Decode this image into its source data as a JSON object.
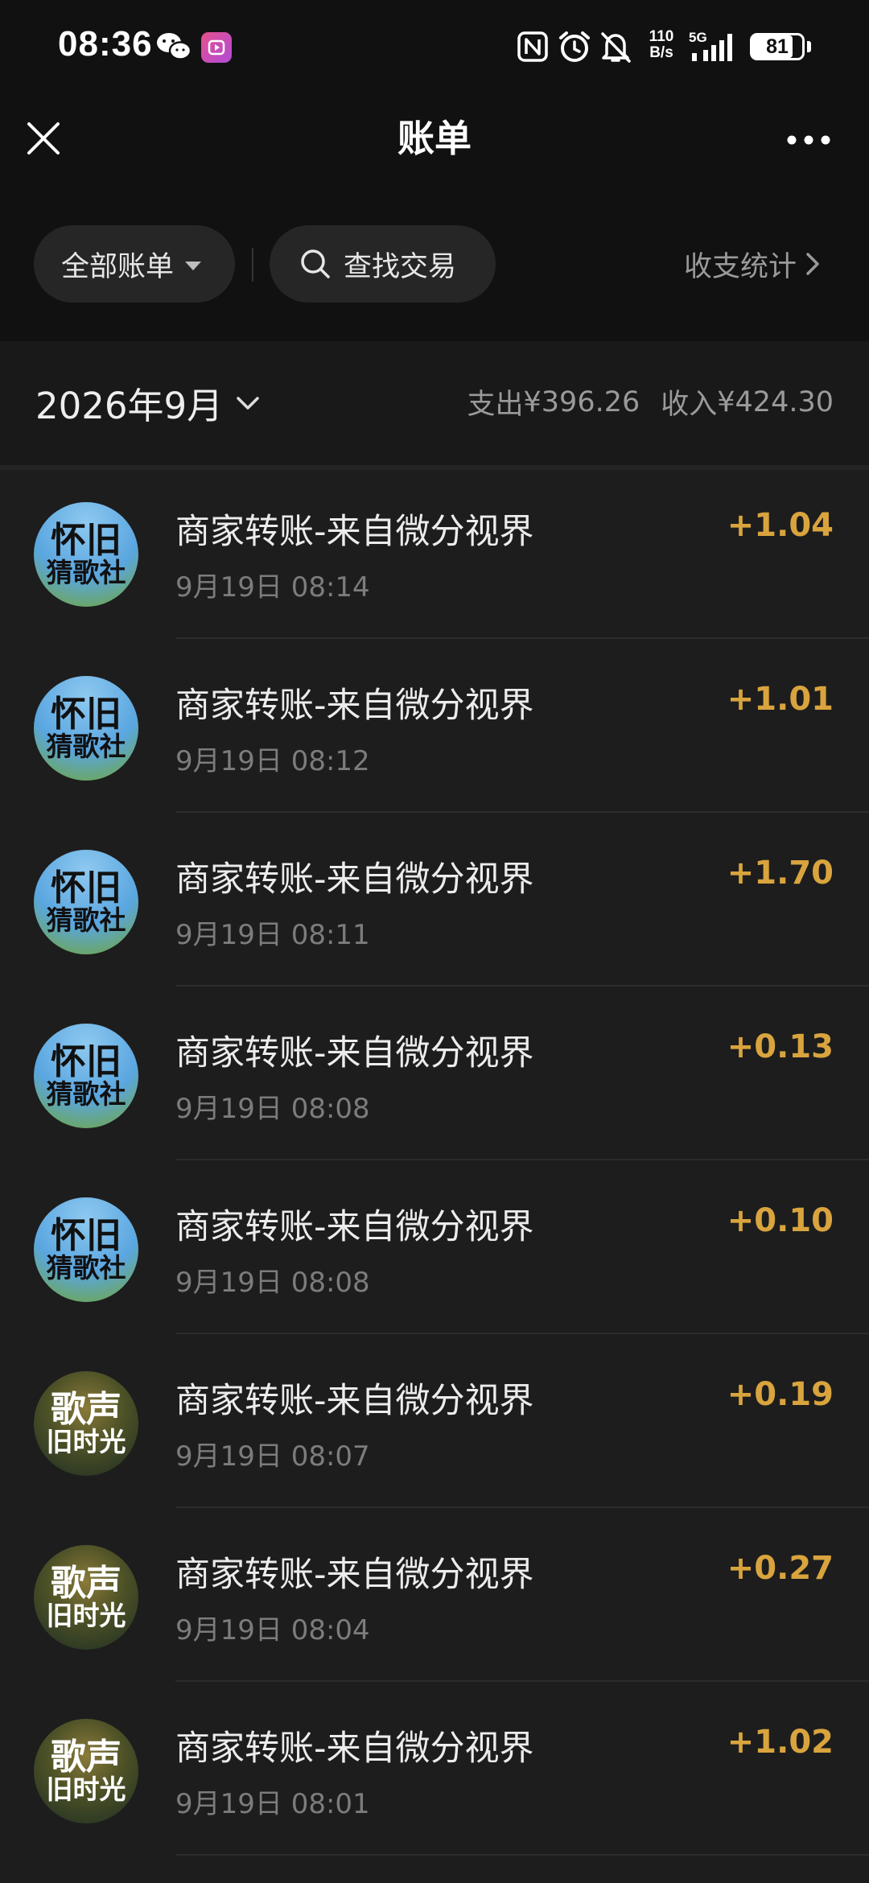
{
  "status_bar": {
    "time": "08:36",
    "net_speed_value": "110",
    "net_speed_unit": "B/s",
    "network_type": "5G",
    "battery": "81",
    "battery_level": 0.81,
    "icons": [
      "wechat-icon",
      "video-app-icon",
      "nfc-icon",
      "alarm-icon",
      "mute-icon",
      "signal-icon",
      "battery-icon"
    ]
  },
  "nav": {
    "title": "账单",
    "close_icon": "close-icon",
    "more_icon": "more-icon"
  },
  "filters": {
    "all_bills": "全部账单",
    "search": "查找交易",
    "stats": "收支统计"
  },
  "month": {
    "label": "2026年9月",
    "expense_label": "支出",
    "expense_value": "¥396.26",
    "income_label": "收入",
    "income_value": "¥424.30"
  },
  "colors": {
    "background": "#111111",
    "list_background": "#1d1d1d",
    "income_amount": "#d9a43e",
    "secondary_text": "#7c7c7c"
  },
  "transactions": [
    {
      "avatar_line1": "怀旧",
      "avatar_line2": "猜歌社",
      "title": "商家转账-来自微分视界",
      "time": "9月19日 08:14",
      "amount": "+1.04"
    },
    {
      "avatar_line1": "怀旧",
      "avatar_line2": "猜歌社",
      "title": "商家转账-来自微分视界",
      "time": "9月19日 08:12",
      "amount": "+1.01"
    },
    {
      "avatar_line1": "怀旧",
      "avatar_line2": "猜歌社",
      "title": "商家转账-来自微分视界",
      "time": "9月19日 08:11",
      "amount": "+1.70"
    },
    {
      "avatar_line1": "怀旧",
      "avatar_line2": "猜歌社",
      "title": "商家转账-来自微分视界",
      "time": "9月19日 08:08",
      "amount": "+0.13"
    },
    {
      "avatar_line1": "怀旧",
      "avatar_line2": "猜歌社",
      "title": "商家转账-来自微分视界",
      "time": "9月19日 08:08",
      "amount": "+0.10"
    },
    {
      "avatar_line1": "歌声",
      "avatar_line2": "旧时光",
      "title": "商家转账-来自微分视界",
      "time": "9月19日 08:07",
      "amount": "+0.19"
    },
    {
      "avatar_line1": "歌声",
      "avatar_line2": "旧时光",
      "title": "商家转账-来自微分视界",
      "time": "9月19日 08:04",
      "amount": "+0.27"
    },
    {
      "avatar_line1": "歌声",
      "avatar_line2": "旧时光",
      "title": "商家转账-来自微分视界",
      "time": "9月19日 08:01",
      "amount": "+1.02"
    }
  ]
}
